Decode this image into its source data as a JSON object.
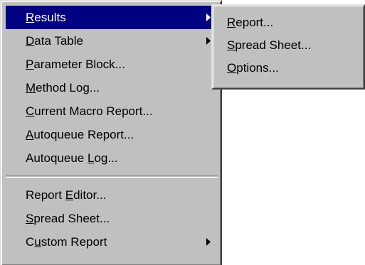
{
  "main_menu": {
    "results": {
      "accel": "R",
      "rest": "esults"
    },
    "data_table": {
      "accel": "D",
      "rest": "ata Table"
    },
    "parameter_block": {
      "accel": "P",
      "rest": "arameter Block..."
    },
    "method_log": {
      "accel": "M",
      "rest": "ethod Log..."
    },
    "current_macro_report": {
      "accel": "C",
      "rest": "urrent Macro Report..."
    },
    "autoqueue_report": {
      "accel": "A",
      "rest": "utoqueue Report..."
    },
    "autoqueue_log": {
      "pre": "Autoqueue ",
      "accel": "L",
      "rest": "og..."
    },
    "report_editor": {
      "pre": "Report ",
      "accel": "E",
      "rest": "ditor..."
    },
    "spread_sheet": {
      "accel": "S",
      "rest": "pread Sheet..."
    },
    "custom_report": {
      "pre": "C",
      "accel": "u",
      "rest": "stom Report"
    }
  },
  "sub_menu": {
    "report": {
      "accel": "R",
      "rest": "eport..."
    },
    "spread_sheet": {
      "accel": "S",
      "rest": "pread Sheet..."
    },
    "options": {
      "accel": "O",
      "rest": "ptions..."
    }
  },
  "colors": {
    "menu_bg": "#c0c0c0",
    "highlight_bg": "#000080",
    "highlight_fg": "#ffffff"
  },
  "icons": {
    "submenu_arrow": "triangle-right"
  }
}
